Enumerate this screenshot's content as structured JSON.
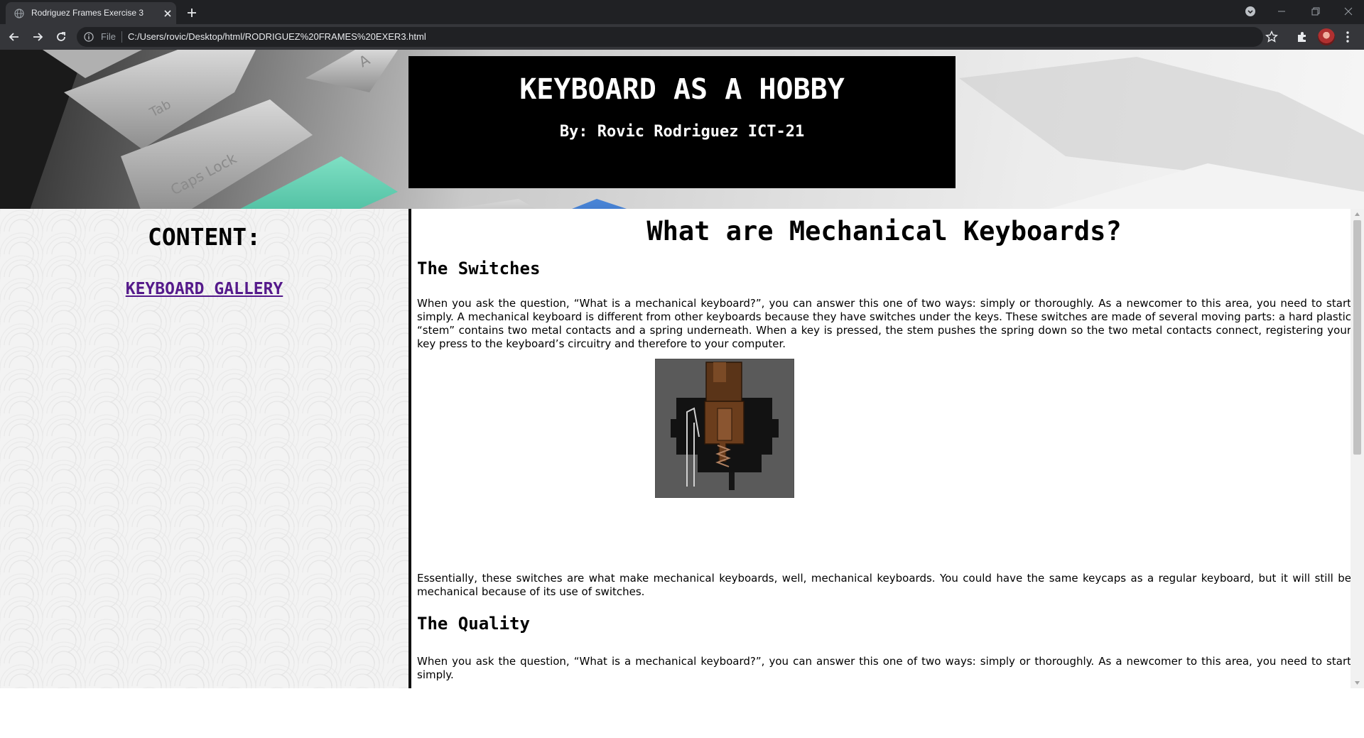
{
  "browser": {
    "tab_title": "Rodriguez Frames Exercise 3",
    "address_scheme": "File",
    "address_url": "C:/Users/rovic/Desktop/html/RODRIGUEZ%20FRAMES%20EXER3.html"
  },
  "banner": {
    "title": "KEYBOARD AS A HOBBY",
    "byline": "By: Rovic Rodriguez ICT-21"
  },
  "sidebar": {
    "heading": "CONTENT:",
    "link": "KEYBOARD GALLERY"
  },
  "article": {
    "title": "What are Mechanical Keyboards?",
    "section1_heading": "The Switches",
    "section1_p1": "When you ask the question, “What is a mechanical keyboard?”, you can answer this one of two ways: simply or thoroughly. As a newcomer to this area, you need to start simply. A mechanical keyboard is different from other keyboards because they have switches under the keys. These switches are made of several moving parts: a hard plastic “stem” contains two metal contacts and a spring underneath. When a key is pressed, the stem pushes the spring down so the two metal contacts connect, registering your key press to the keyboard’s circuitry and therefore to your computer.",
    "section1_p2": "Essentially, these switches are what make mechanical keyboards, well, mechanical keyboards. You could have the same keycaps as a regular keyboard, but it will still be mechanical because of its use of switches.",
    "section2_heading": "The Quality",
    "section2_p1": "When you ask the question, “What is a mechanical keyboard?”, you can answer this one of two ways: simply or thoroughly. As a newcomer to this area, you need to start simply."
  },
  "icons": {
    "favicon": "globe-icon",
    "close": "close-icon",
    "new_tab": "plus-icon",
    "back": "back-arrow-icon",
    "forward": "forward-arrow-icon",
    "reload": "reload-icon",
    "info": "info-icon",
    "bookmark": "star-icon",
    "extensions": "puzzle-icon",
    "menu": "kebab-menu-icon"
  }
}
